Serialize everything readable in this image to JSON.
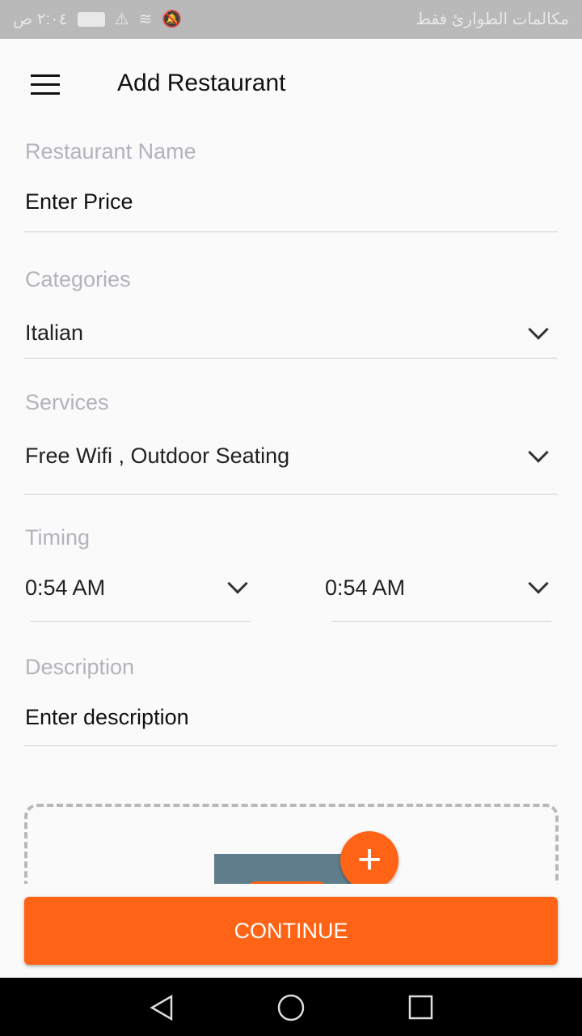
{
  "status": {
    "time": "٢:٠٤ ص",
    "carrier": "مكالمات الطوارئ فقط"
  },
  "header": {
    "title": "Add Restaurant"
  },
  "form": {
    "name": {
      "label": "Restaurant Name",
      "value": "Enter Price"
    },
    "categories": {
      "label": "Categories",
      "value": "Italian"
    },
    "services": {
      "label": "Services",
      "value": "Free Wifi , Outdoor Seating"
    },
    "timing": {
      "label": "Timing",
      "start": "0:54 AM",
      "end": "0:54 AM"
    },
    "description": {
      "label": "Description",
      "value": "Enter description"
    }
  },
  "upload": {
    "add_icon": "plus-icon"
  },
  "continue_label": "CONTINUE",
  "colors": {
    "accent": "#ff6316",
    "image_placeholder": "#607d8b"
  }
}
